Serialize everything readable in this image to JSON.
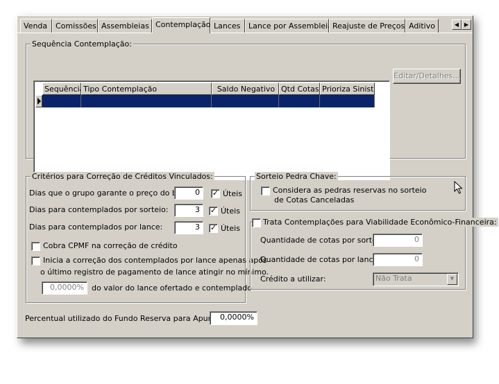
{
  "tabs": [
    "Venda",
    "Comissões",
    "Assembleias",
    "Contemplação",
    "Lances",
    "Lance por Assembleia",
    "Reajuste de Preços",
    "Aditivo"
  ],
  "active_tab": "Contemplação",
  "sequencia": {
    "legend": "Sequência Contemplação:",
    "columns": [
      "Sequência",
      "Tipo Contemplação",
      "Saldo Negativo",
      "Qtd Cotas",
      "Prioriza Sinistro"
    ],
    "edit_button": "Editar/Detalhes..."
  },
  "criterios": {
    "legend": "Critérios para Correção de Créditos Vinculados:",
    "row1_label": "Dias que o grupo garante o preço do bem:",
    "row1_value": "0",
    "row2_label": "Dias para contemplados por sorteio:",
    "row2_value": "3",
    "row3_label": "Dias para contemplados por lance:",
    "row3_value": "3",
    "uteis_label": "Úteis",
    "cpmf_label": "Cobra CPMF na correção de crédito",
    "inicia_line1": "Inicia a correção dos contemplados por lance apenas após",
    "inicia_line2": "o último registro de pagamento de lance atingir no mínimo.",
    "percent_value": "0,0000%",
    "percent_label": "do valor do lance ofertado e contemplado."
  },
  "sorteio": {
    "legend": "Sorteio Pedra Chave:",
    "check_line1": "Considera as pedras reservas no sorteio",
    "check_line2": "de Cotas Canceladas"
  },
  "viabilidade": {
    "legend": "Trata Contemplações para Viabilidade Econômico-Financeira:",
    "qtd_sorteio_label": "Quantidade de cotas por sorteio:",
    "qtd_sorteio_value": "0",
    "qtd_lance_label": "Quantidade de cotas por lance:",
    "qtd_lance_value": "0",
    "credito_label": "Crédito a utilizar:",
    "credito_value": "Não Trata"
  },
  "fundo_reserva": {
    "label": "Percentual utilizado do Fundo Reserva para Apuração:",
    "value": "0,0000%"
  }
}
